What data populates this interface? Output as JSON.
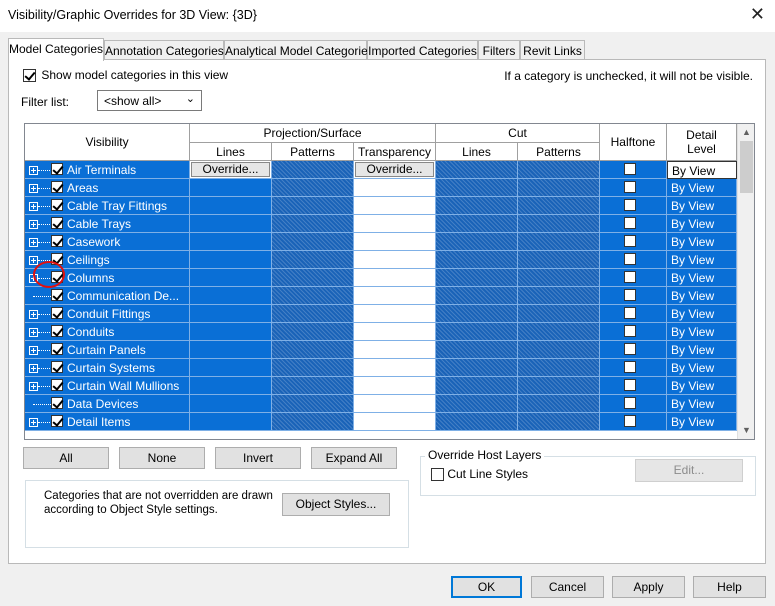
{
  "window": {
    "title": "Visibility/Graphic Overrides for 3D View: {3D}",
    "close_glyph": "✕"
  },
  "tabs": [
    {
      "label": "Model Categories",
      "active": true
    },
    {
      "label": "Annotation Categories"
    },
    {
      "label": "Analytical Model Categories"
    },
    {
      "label": "Imported Categories"
    },
    {
      "label": "Filters"
    },
    {
      "label": "Revit Links"
    }
  ],
  "show_model_categories": {
    "label": "Show model categories in this view",
    "checked": true
  },
  "hint": "If a category is unchecked, it will not be visible.",
  "filter": {
    "label": "Filter list:",
    "value": "<show all>"
  },
  "table": {
    "headers": {
      "visibility": "Visibility",
      "projection_surface": "Projection/Surface",
      "lines": "Lines",
      "patterns": "Patterns",
      "transparency": "Transparency",
      "cut": "Cut",
      "cut_lines": "Lines",
      "cut_patterns": "Patterns",
      "halftone": "Halftone",
      "detail_level": "Detail\nLevel"
    },
    "override_label": "Override...",
    "rows": [
      {
        "name": "Air Terminals",
        "checked": true,
        "expandable": true,
        "detail": "By View",
        "selected": true
      },
      {
        "name": "Areas",
        "checked": true,
        "expandable": true,
        "detail": "By View"
      },
      {
        "name": "Cable Tray Fittings",
        "checked": true,
        "expandable": true,
        "detail": "By View"
      },
      {
        "name": "Cable Trays",
        "checked": true,
        "expandable": true,
        "detail": "By View"
      },
      {
        "name": "Casework",
        "checked": true,
        "expandable": true,
        "detail": "By View"
      },
      {
        "name": "Ceilings",
        "checked": true,
        "expandable": true,
        "detail": "By View"
      },
      {
        "name": "Columns",
        "checked": true,
        "expandable": true,
        "detail": "By View",
        "highlighted": true
      },
      {
        "name": "Communication De...",
        "checked": true,
        "expandable": false,
        "detail": "By View"
      },
      {
        "name": "Conduit Fittings",
        "checked": true,
        "expandable": true,
        "detail": "By View"
      },
      {
        "name": "Conduits",
        "checked": true,
        "expandable": true,
        "detail": "By View"
      },
      {
        "name": "Curtain Panels",
        "checked": true,
        "expandable": true,
        "detail": "By View"
      },
      {
        "name": "Curtain Systems",
        "checked": true,
        "expandable": true,
        "detail": "By View"
      },
      {
        "name": "Curtain Wall Mullions",
        "checked": true,
        "expandable": true,
        "detail": "By View"
      },
      {
        "name": "Data Devices",
        "checked": true,
        "expandable": false,
        "detail": "By View"
      },
      {
        "name": "Detail Items",
        "checked": true,
        "expandable": true,
        "detail": "By View"
      }
    ]
  },
  "buttons": {
    "all": "All",
    "none": "None",
    "invert": "Invert",
    "expand_all": "Expand All",
    "object_styles": "Object Styles...",
    "edit": "Edit...",
    "ok": "OK",
    "cancel": "Cancel",
    "apply": "Apply",
    "help": "Help"
  },
  "info_text": "Categories that are not overridden are drawn according to Object Style settings.",
  "override_host_layers": {
    "title": "Override Host Layers",
    "cut_line_styles": {
      "label": "Cut Line Styles",
      "checked": false
    }
  },
  "colors": {
    "selection_blue": "#0a6fd6",
    "highlight_red": "#e01010",
    "default_button_border": "#0078d7"
  }
}
